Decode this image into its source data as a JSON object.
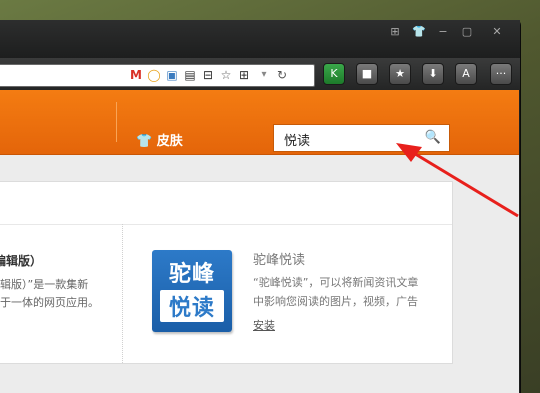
{
  "window": {
    "title_buttons": [
      {
        "name": "grid-icon",
        "glyph": "⊞"
      },
      {
        "name": "shirt-icon",
        "glyph": "👕"
      },
      {
        "name": "minimize-icon",
        "glyph": "−"
      },
      {
        "name": "restore-icon",
        "glyph": "▢"
      },
      {
        "name": "close-icon",
        "glyph": "✕"
      }
    ]
  },
  "toolbar": {
    "extensions": [
      "gmail-icon",
      "chat-bubble-icon",
      "image-icon",
      "save-icon",
      "block-icon",
      "star-add-icon",
      "qr-icon"
    ],
    "k_label": "K",
    "right_buttons": [
      {
        "name": "lock-icon",
        "glyph": "🔒"
      },
      {
        "name": "star-icon",
        "glyph": "★"
      },
      {
        "name": "download-icon",
        "glyph": "⬇"
      },
      {
        "name": "font-icon",
        "glyph": "A"
      },
      {
        "name": "more-icon",
        "glyph": "···"
      }
    ]
  },
  "header": {
    "skin_label": "皮肤",
    "search_value": "悦读"
  },
  "cards": {
    "left": {
      "title": "编辑版）",
      "line1": "辑版）”是一款集新",
      "line2": "于一体的网页应用。"
    },
    "right": {
      "logo_top": "驼峰",
      "logo_bottom": "悦读",
      "title": "驼峰悦读",
      "line1": "“驼峰悦读”，可以将新闻资讯文章",
      "line2": "中影响您阅读的图片，视频，广告",
      "install": "安装"
    }
  },
  "colors": {
    "accent_orange": "#ee7310",
    "annotation_red": "#e8201c"
  }
}
